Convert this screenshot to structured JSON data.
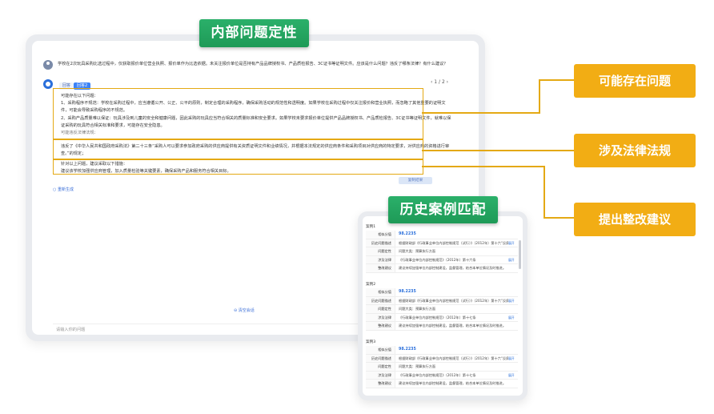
{
  "titles": {
    "main": "内部问题定性",
    "history": "历史案例匹配"
  },
  "question": "学校在2次玩具采购比选过程中，仅获取报价单位营业执照、报价单作为比选依据。未关注报价单位是否持有产品品牌授权书、产品质检报告、3C证书等证明文件。应该是什么问题？违反了哪条法律？有什么建议？",
  "answer": {
    "pager": "‹ 1 / 2 ›",
    "tabs": [
      "回答",
      "回答2"
    ],
    "issues_title": "可能存在以下问题：",
    "issue1": "1、采购程序不规范：学校在采购过程中，应当遵循公开、公正、公平的原则，制定合理的采购程序，确保采购活动的规范性和透明度。如果学校在采购过程中仅关注报价和营业执照，而忽略了其他重要的证明文件，可能会导致采购程序的不规范。",
    "issue2": "2、采购产品质量难以保证：玩具涉及到儿童的安全和健康问题，因此采购的玩具应当符合相关的质量标准和安全要求。如果学校未要求报价单位提供产品品牌授权书、产品质检报告、3C证书等证明文件，就难以保证采购的玩具符合相关标准和要求，可能存在安全隐患。",
    "issue3": "可能违反法律法规：",
    "law": "违反了《中华人民共和国政府采购法》第二十三条“采购人可以要求参加政府采购的供应商提供有关资质证明文件和业绩情况，并根据本法规定的供应商条件和采购项目对供应商的特定要求，对供应商的资格进行审查。”的规定；",
    "advice_title": "针对以上问题，建议采取以下措施：",
    "advice": "建议该学校加强供应商管理，加入质量检验等关键要素，确保采购产品和服务符合相关目标。",
    "copy": "复制结果",
    "regen": "重新生成",
    "clear": "清空会话",
    "input_placeholder": "请输入你的问题"
  },
  "callouts": {
    "c1": "可能存在问题",
    "c2": "涉及法律法规",
    "c3": "提出整改建议"
  },
  "history": {
    "labels": {
      "score": "相似分值",
      "desc": "历史问题描述",
      "nature": "问题定性",
      "law": "涉及法律",
      "advice": "整改建议",
      "more": "展开"
    },
    "cases": [
      {
        "title": "案例1",
        "score": "98.2235",
        "desc": "根据财政部《行政事业单位内部控制规范（试行）》（2012年）第十六“反腐败责任…",
        "nature": "问题大类：预算执行方面",
        "law": "《行政事业单位内部控制规范》（2012年）第十六条",
        "advice": "建议持续加强单位内部控制建设，监督管理，结合本单位情况及时推进。"
      },
      {
        "title": "案例2",
        "score": "98.2235",
        "desc": "根据财政部《行政事业单位内部控制规范（试行）》（2012年）第十六“反腐败责任…",
        "nature": "问题大类：预算执行方面",
        "law": "《行政事业单位内部控制规范》（2012年）第十七条",
        "advice": "建议持续加强单位内部控制建设，监督管理，结合本单位情况及时推进。"
      },
      {
        "title": "案例3",
        "score": "98.2235",
        "desc": "根据财政部《行政事业单位内部控制规范（试行）》（2012年）第十六“反腐败责任…",
        "nature": "问题大类：预算执行方面",
        "law": "《行政事业单位内部控制规范》（2012年）第十七条",
        "advice": "建议持续加强单位内部控制建设，监督管理，结合本单位情况及时推进。"
      }
    ]
  },
  "colors": {
    "highlight": "#e4a914",
    "callout": "#f2ad14",
    "title_green": "#1e9a57",
    "accent_blue": "#2a6fdb"
  }
}
